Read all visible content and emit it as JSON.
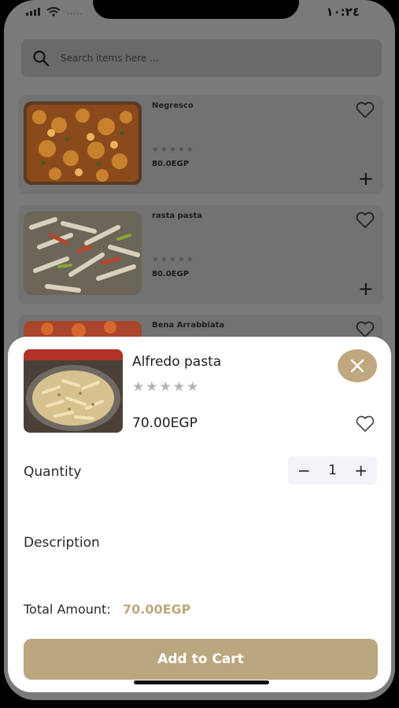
{
  "status_bar": {
    "time": "١٠:٢٤",
    "carrier": "....."
  },
  "search": {
    "placeholder": "Search items here ...",
    "icon": "search-icon"
  },
  "items": [
    {
      "name": "Negresco",
      "stars": "★★★★★",
      "price": "80.0EGP",
      "favorite_icon": "heart-outline-icon",
      "add_icon": "plus-icon"
    },
    {
      "name": "rasta pasta",
      "stars": "★★★★★",
      "price": "80.0EGP",
      "favorite_icon": "heart-outline-icon",
      "add_icon": "plus-icon"
    },
    {
      "name": "Bena Arrabbiata",
      "favorite_icon": "heart-outline-icon"
    }
  ],
  "detail_sheet": {
    "title": "Alfredo pasta",
    "stars": "★★★★★",
    "price": "70.00EGP",
    "quantity_label": "Quantity",
    "quantity": "1",
    "minus": "−",
    "plus": "+",
    "description_label": "Description",
    "total_label": "Total Amount:",
    "total_value": "70.00EGP",
    "add_to_cart": "Add to Cart",
    "accent_color": "#bfa77f"
  },
  "plus_glyph": "+"
}
